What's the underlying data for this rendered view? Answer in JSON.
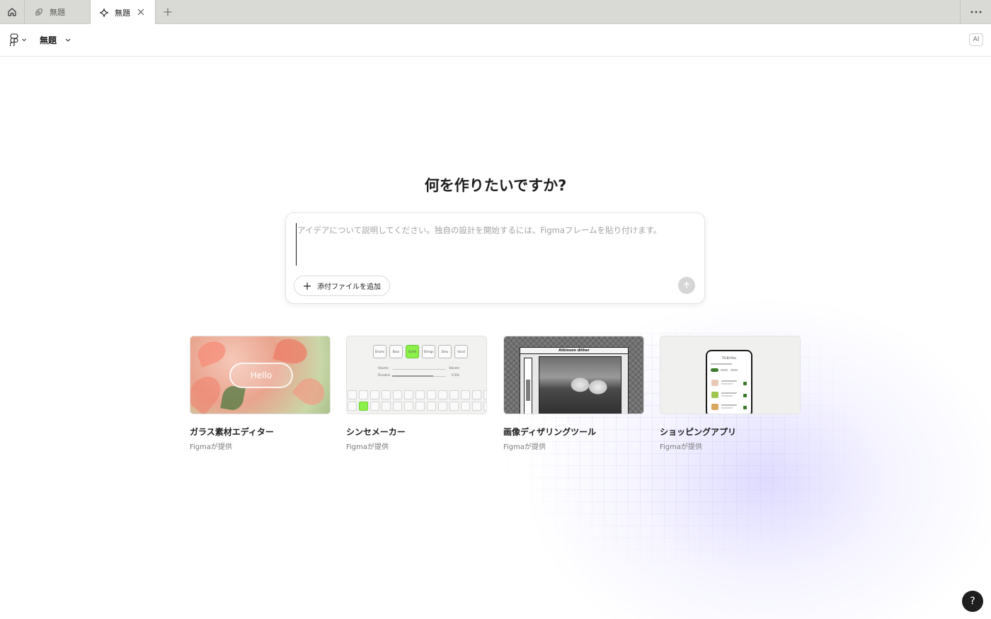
{
  "tabs": {
    "home_icon": "home-icon",
    "items": [
      {
        "label": "無題",
        "icon": "figjam-icon",
        "active": false
      },
      {
        "label": "無題",
        "icon": "make-icon",
        "active": true
      }
    ],
    "new_tab_icon": "plus-icon",
    "more_icon": "ellipsis-icon"
  },
  "toolbar": {
    "logo_icon": "figma-logo-icon",
    "file_title": "無題",
    "ai_badge": "AI"
  },
  "main": {
    "heading": "何を作りたいですか?",
    "prompt": {
      "value": "",
      "placeholder": "アイデアについて説明してください。独自の設計を開始するには、Figmaフレームを貼り付けます。",
      "attach_label": "添付ファイルを追加",
      "send_icon": "arrow-up-icon"
    },
    "templates": [
      {
        "title": "ガラス素材エディター",
        "subtitle": "Figmaが提供",
        "preview_text": "Hello"
      },
      {
        "title": "シンセメーカー",
        "subtitle": "Figmaが提供",
        "preview_buttons": [
          "Drums",
          "Bass",
          "Synth",
          "Strings",
          "Dreu",
          "Vocal"
        ],
        "preview_sliders": [
          {
            "label": "Volume",
            "right": "Volume"
          },
          {
            "label": "Duration",
            "right": "0.50s"
          }
        ]
      },
      {
        "title": "画像ディザリングツール",
        "subtitle": "Figmaが提供",
        "preview_title": "Atkinson dither"
      },
      {
        "title": "ショッピングアプリ",
        "subtitle": "Figmaが提供",
        "preview_header": "TO-BI Pies"
      }
    ]
  },
  "help": {
    "label": "?"
  },
  "colors": {
    "accent_green": "#8cf04a",
    "tabbar_bg": "#d9d9d6",
    "help_bg": "#1e1e1e"
  }
}
